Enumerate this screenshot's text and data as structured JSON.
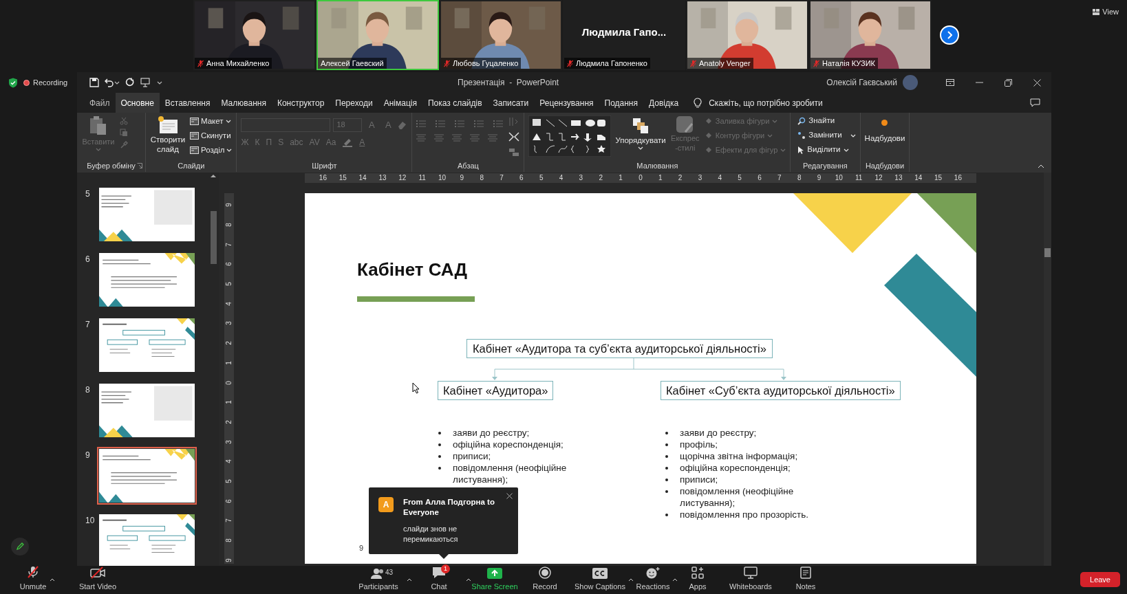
{
  "zoom": {
    "view_label": "View",
    "recording_label": "Recording"
  },
  "videos": [
    {
      "name": "Анна Михайленко",
      "muted": true,
      "speaking": false,
      "has_video": true
    },
    {
      "name": "Алексей Гаевский",
      "muted": false,
      "speaking": true,
      "has_video": true
    },
    {
      "name": "Любовь Гуцаленко",
      "muted": true,
      "speaking": false,
      "has_video": true
    },
    {
      "name": "Людмила Гапоненко",
      "muted": true,
      "speaking": false,
      "has_video": false,
      "display_name": "Людмила  Гапо..."
    },
    {
      "name": "Anatoly Venger",
      "muted": true,
      "speaking": false,
      "has_video": true
    },
    {
      "name": "Наталія КУЗИК",
      "muted": true,
      "speaking": false,
      "has_video": true
    }
  ],
  "powerpoint": {
    "title": "Презентація  -  PowerPoint",
    "user": "Олексій Гаєвський",
    "tabs": [
      {
        "label": "Файл",
        "selected": false
      },
      {
        "label": "Основне",
        "selected": true
      },
      {
        "label": "Вставлення",
        "selected": false
      },
      {
        "label": "Малювання",
        "selected": false
      },
      {
        "label": "Конструктор",
        "selected": false
      },
      {
        "label": "Переходи",
        "selected": false
      },
      {
        "label": "Анімація",
        "selected": false
      },
      {
        "label": "Показ слайдів",
        "selected": false
      },
      {
        "label": "Записати",
        "selected": false
      },
      {
        "label": "Рецензування",
        "selected": false
      },
      {
        "label": "Подання",
        "selected": false
      },
      {
        "label": "Довідка",
        "selected": false
      }
    ],
    "tell_me": "Скажіть, що потрібно зробити",
    "ribbon": {
      "clipboard": {
        "label": "Буфер обміну",
        "paste": "Вставити",
        "disabled": true
      },
      "slides": {
        "label": "Слайди",
        "new_slide": "Створити слайд",
        "layout": "Макет",
        "reset": "Скинути",
        "section": "Розділ"
      },
      "font": {
        "label": "Шрифт",
        "size": "18",
        "size_buttons": [
          "A",
          "A"
        ],
        "format_buttons": [
          "Ж",
          "К",
          "П",
          "S",
          "abc",
          "AV",
          "Aa"
        ],
        "color_button": "A",
        "disabled": true
      },
      "paragraph": {
        "label": "Абзац",
        "disabled": true
      },
      "drawing": {
        "label": "Малювання",
        "arrange": "Упорядкувати",
        "quick_styles": "Експрес-стилі",
        "fill": "Заливка фігури",
        "outline": "Контур фігури",
        "effects": "Ефекти для фігур",
        "disabled": true
      },
      "editing": {
        "label": "Редагування",
        "find": "Знайти",
        "replace": "Замінити",
        "select": "Виділити"
      },
      "addins": {
        "label": "Надбудови",
        "button": "Надбудови"
      }
    },
    "ruler": {
      "horizontal": [
        "16",
        "15",
        "14",
        "13",
        "12",
        "11",
        "10",
        "9",
        "8",
        "7",
        "6",
        "5",
        "4",
        "3",
        "2",
        "1",
        "0",
        "1",
        "2",
        "3",
        "4",
        "5",
        "6",
        "7",
        "8",
        "9",
        "10",
        "11",
        "12",
        "13",
        "14",
        "15",
        "16"
      ],
      "vertical": [
        "9",
        "8",
        "7",
        "6",
        "5",
        "4",
        "3",
        "2",
        "1",
        "0",
        "1",
        "2",
        "3",
        "4",
        "5",
        "6",
        "7",
        "8",
        "9"
      ]
    },
    "thumbnails": [
      {
        "number": "5",
        "selected": false
      },
      {
        "number": "6",
        "selected": false
      },
      {
        "number": "7",
        "selected": false
      },
      {
        "number": "8",
        "selected": false
      },
      {
        "number": "9",
        "selected": true
      },
      {
        "number": "10",
        "selected": false
      }
    ],
    "slide": {
      "title": "Кабінет САД",
      "number": "9",
      "top_box": "Кабінет «Аудитора та суб’єкта аудиторської діяльності»",
      "left_box": "Кабінет «Аудитора»",
      "right_box": "Кабінет «Суб’єкта аудиторської діяльності»",
      "left_list": [
        "заяви до реєстру;",
        "офіційна кореспонденція;",
        "приписи;",
        "повідомлення (неофіційне листування);"
      ],
      "right_list": [
        "заяви до реєстру;",
        "профіль;",
        "щорічна звітна інформація;",
        "офіційна кореспонденція;",
        "приписи;",
        "повідомлення (неофіційне листування);",
        "повідомлення про прозорість."
      ]
    }
  },
  "chat_popup": {
    "initial": "A",
    "title": "From Алла Подгорна to Everyone",
    "message": "слайди знов не перемикаються"
  },
  "toolbar": [
    {
      "kind": "mic",
      "label": "Unmute",
      "caret": true
    },
    {
      "kind": "video",
      "label": "Start Video",
      "caret": false
    },
    {
      "kind": "participants",
      "label": "Participants",
      "count": "43",
      "caret": true
    },
    {
      "kind": "chat",
      "label": "Chat",
      "badge": "1",
      "caret": true
    },
    {
      "kind": "share",
      "label": "Share Screen",
      "caret": false
    },
    {
      "kind": "record",
      "label": "Record",
      "caret": false
    },
    {
      "kind": "captions",
      "label": "Show Captions",
      "caret": true
    },
    {
      "kind": "reactions",
      "label": "Reactions",
      "caret": true
    },
    {
      "kind": "apps",
      "label": "Apps",
      "caret": false
    },
    {
      "kind": "whiteboards",
      "label": "Whiteboards",
      "caret": false
    },
    {
      "kind": "notes",
      "label": "Notes",
      "caret": false
    }
  ],
  "leave_label": "Leave"
}
